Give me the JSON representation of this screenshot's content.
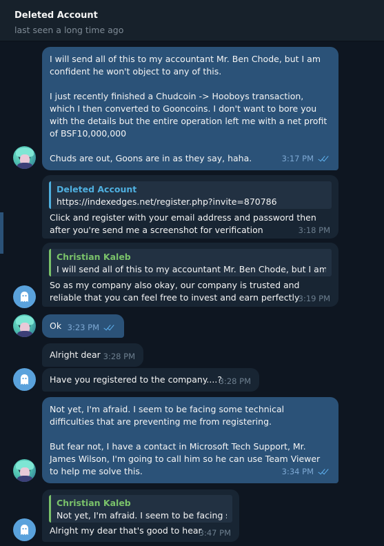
{
  "header": {
    "title": "Deleted Account",
    "status": "last seen a long time ago"
  },
  "messages": [
    {
      "direction": "out",
      "paragraphs": [
        "I will send all of this to my accountant Mr. Ben Chode, but I am confident he won't object to any of this.",
        "I just recently finished a Chudcoin -> Hooboys transaction, which I then converted to Gooncoins. I don't want to bore you with the details but the entire operation left me with a net profit of BSF10,000,000",
        "Chuds are out, Goons are in as they say, haha."
      ],
      "time": "3:17 PM",
      "read": true
    },
    {
      "direction": "in",
      "reply_name": "Deleted Account",
      "reply_text": "https://indexedges.net/register.php?invite=870786",
      "text": "Click and register with your email address and password then after you're send me a screenshot for verification",
      "time": "3:18 PM"
    },
    {
      "direction": "in",
      "reply_name": "Christian Kaleb",
      "reply_text": "I will send all of this to my accountant Mr. Ben Chode, but I am c...",
      "text": "So as my company also okay, our company is trusted and reliable that you can feel free to invest and earn perfectly",
      "time": "3:19 PM"
    },
    {
      "direction": "out",
      "text": "Ok",
      "time": "3:23 PM",
      "read": true
    },
    {
      "direction": "in",
      "text": "Alright dear",
      "time": "3:28 PM"
    },
    {
      "direction": "in",
      "text": "Have you registered to the company....?",
      "time": "3:28 PM"
    },
    {
      "direction": "out",
      "paragraphs": [
        "Not yet, I'm afraid. I seem to be facing some technical difficulties that are preventing me from registering.",
        "But fear not, I have a contact in Microsoft Tech Support, Mr. James Wilson, I'm going to call him so he can use Team Viewer to help me solve this."
      ],
      "time": "3:34 PM",
      "read": true
    },
    {
      "direction": "in",
      "reply_name": "Christian Kaleb",
      "reply_text": "Not yet, I'm afraid. I seem to be facing s...",
      "text": "Alright my dear that's good to hear",
      "time": "3:47 PM"
    }
  ],
  "colors": {
    "background": "#0e1621",
    "outgoing_bubble": "#2b5278",
    "incoming_bubble": "#182533",
    "reply_link_name": "#4fb0e0",
    "reply_green_name": "#7ac26a",
    "read_check": "#5fb2f0"
  },
  "icons": {
    "contact_avatar": "ghost-avatar-icon",
    "self_avatar": "user-avatar",
    "read_receipt": "double-check-icon"
  }
}
